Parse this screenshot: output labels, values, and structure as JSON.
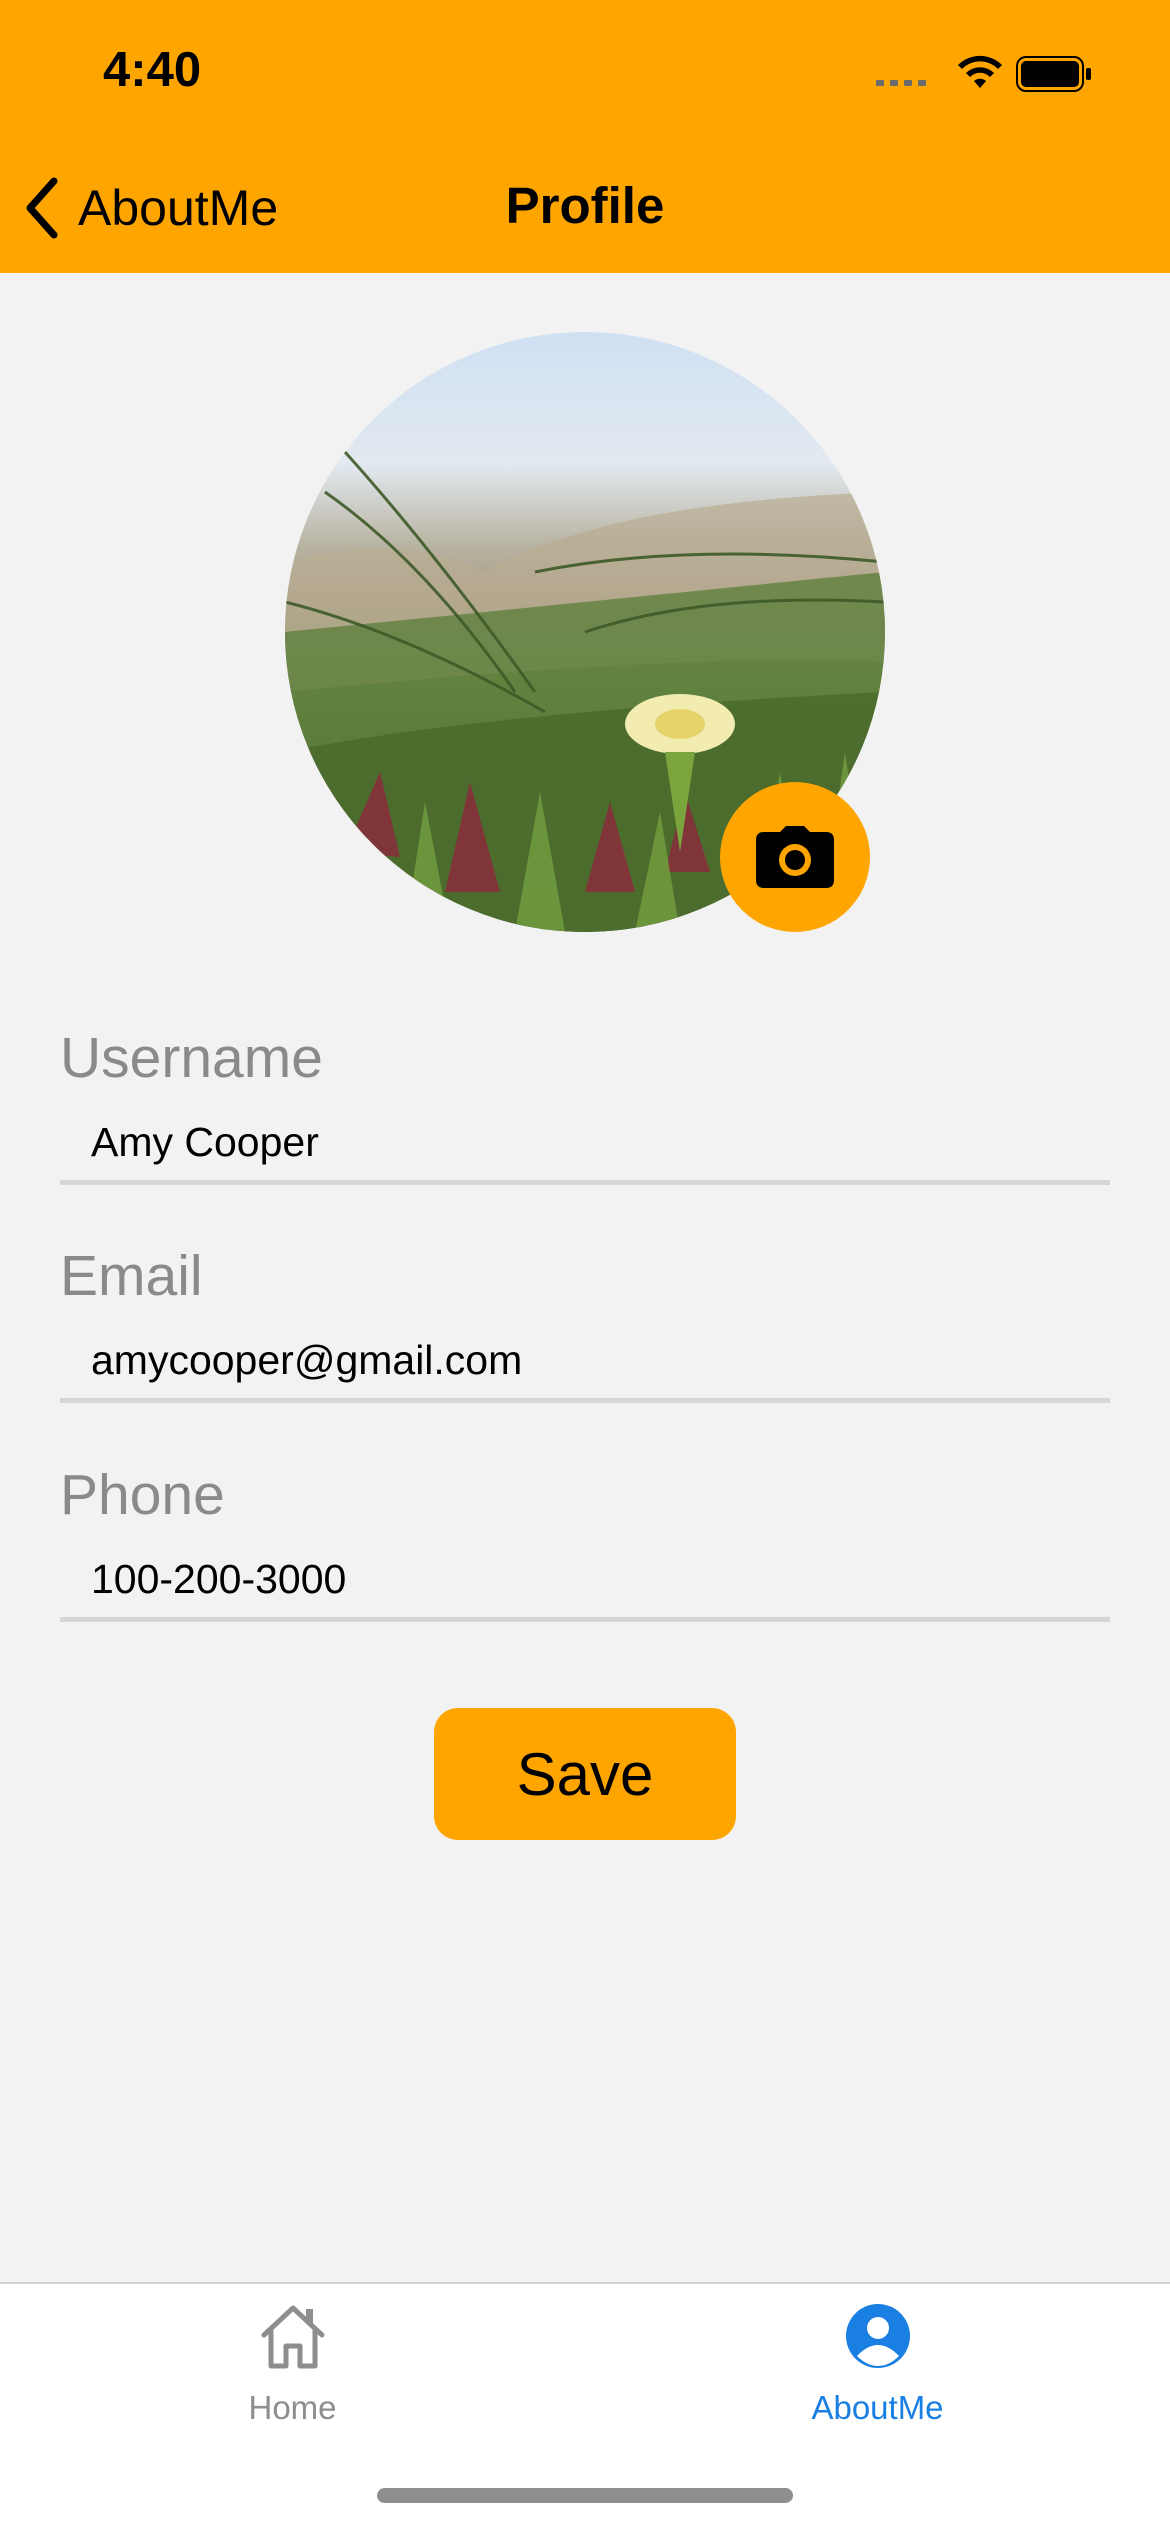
{
  "status_bar": {
    "time": "4:40",
    "icons": [
      "cellular-signal-icon",
      "wifi-icon",
      "battery-icon"
    ]
  },
  "nav": {
    "back_label": "AboutMe",
    "title": "Profile"
  },
  "avatar": {
    "icon": "camera-icon"
  },
  "form": {
    "username": {
      "label": "Username",
      "value": "Amy Cooper"
    },
    "email": {
      "label": "Email",
      "value": "amycooper@gmail.com"
    },
    "phone": {
      "label": "Phone",
      "value": "100-200-3000"
    }
  },
  "actions": {
    "save_label": "Save"
  },
  "tab_bar": {
    "tabs": [
      {
        "label": "Home",
        "icon": "home-icon",
        "active": false
      },
      {
        "label": "AboutMe",
        "icon": "profile-icon",
        "active": true
      }
    ]
  },
  "colors": {
    "accent": "#ffa500",
    "active_tab": "#1a7fe3",
    "inactive_tab": "#8e8e8e",
    "background": "#f2f2f2"
  }
}
